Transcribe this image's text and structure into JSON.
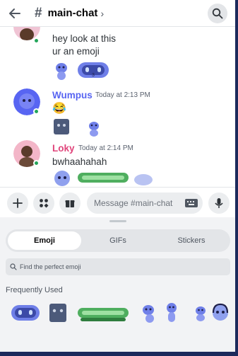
{
  "header": {
    "back_icon": "arrow-left-icon",
    "hash": "#",
    "channel": "main-chat",
    "chevron": "›",
    "search_icon": "search-icon"
  },
  "messages": [
    {
      "author": "",
      "lines": [
        "hey look at this",
        "ur an emoji"
      ]
    },
    {
      "author": "Wumpus",
      "time": "Today at 2:13 PM",
      "text": "😂",
      "author_color": "#5865f2"
    },
    {
      "author": "Loky",
      "time": "Today at 2:14 PM",
      "text": "bwhaahahah",
      "author_color": "#e0457b"
    }
  ],
  "input_bar": {
    "placeholder": "Message #main-chat",
    "buttons": [
      "plus-icon",
      "apps-icon",
      "gift-icon"
    ],
    "keyboard_icon": "keyboard-icon",
    "mic_icon": "microphone-icon"
  },
  "picker": {
    "tabs": [
      "Emoji",
      "GIFs",
      "Stickers"
    ],
    "active_tab": "Emoji",
    "search_placeholder": "Find the perfect emoji",
    "section": "Frequently Used",
    "emojis": [
      "wumpus-robot-emoji",
      "wumpus-gray-emoji",
      "snake-emoji",
      "wumpus-dance-emoji",
      "wumpus-stand-emoji",
      "wumpus-wave-emoji",
      "wumpus-headset-emoji"
    ]
  },
  "colors": {
    "accent": "#5865f2",
    "online": "#23a55a",
    "frame": "#1c2a5c"
  }
}
